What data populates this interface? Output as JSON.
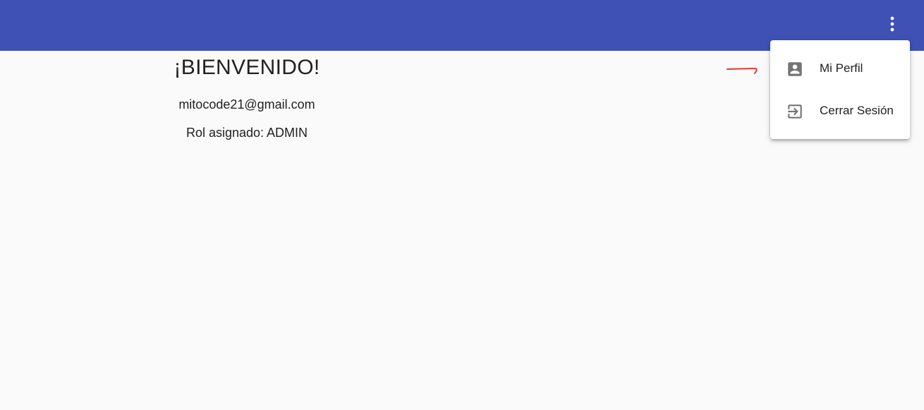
{
  "toolbar": {
    "color": "#3f51b5",
    "more_icon": "more-vert-icon"
  },
  "welcome": {
    "title": "¡BIENVENIDO!",
    "email": "mitocode21@gmail.com",
    "role_label": "Rol asignado:",
    "role_value": "ADMIN"
  },
  "menu": {
    "items": [
      {
        "label": "Mi Perfil",
        "icon": "account-box-icon"
      },
      {
        "label": "Cerrar Sesión",
        "icon": "exit-to-app-icon"
      }
    ]
  },
  "annotation": {
    "color": "#e53935",
    "icon": "red-arrow-annotation"
  }
}
